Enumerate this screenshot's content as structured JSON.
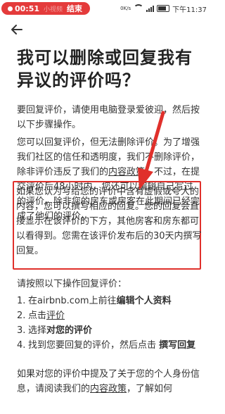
{
  "status_bar": {
    "rec_time": "00:51",
    "rec_hidden_text": "小视频",
    "rec_end_label": "结束",
    "network": "0K/s",
    "battery": "67",
    "time": "下午11:37"
  },
  "nav": {
    "back_icon": "arrow-left-icon"
  },
  "title": "我可以删除或回复我有异议的评价吗？",
  "paragraphs": {
    "p1": "要回复评价，请使用电脑登录爱彼迎，然后按以下步骤操作。",
    "p2_a": "您可以回复评价，但无法删除评价。为了增强我们社区的信任和透明度，我们不删除评价，除非评价违反了我们的",
    "p2_link": "内容政策",
    "p2_b": "。不过，在提交评价后48小时内，您还可以编辑自己写过的评价，除非您的房东或房客在此期间已经完成了他们的评价。",
    "p3": "如果您认为写给您的评价中含有虚假或夸大的内容，您可以撰写相应的回复。您的回复会直接显示在该评价的下方，其他房客和房东都可以看得到。您需在该评价发布后的30天内撰写回复。",
    "p4": "请按照以下操作回复评价："
  },
  "steps": [
    {
      "num": "1.",
      "pre": "在airbnb.com上前往",
      "bold": "编辑个人资料",
      "link": ""
    },
    {
      "num": "2.",
      "pre": "点击",
      "bold": "",
      "link": "评价"
    },
    {
      "num": "3.",
      "pre": "选择",
      "bold": "对您的评价",
      "link": ""
    },
    {
      "num": "4.",
      "pre": "找到您要回复的评价，然后点击 ",
      "bold": "撰写回复",
      "link": ""
    }
  ],
  "footer": {
    "a": "如果对您的评价中提及了关于您的个人身份信息，请阅读我们的",
    "link": "内容政策",
    "b": "，了解如何"
  },
  "colors": {
    "highlight": "#e0302b",
    "recording": "#e43b3b"
  }
}
